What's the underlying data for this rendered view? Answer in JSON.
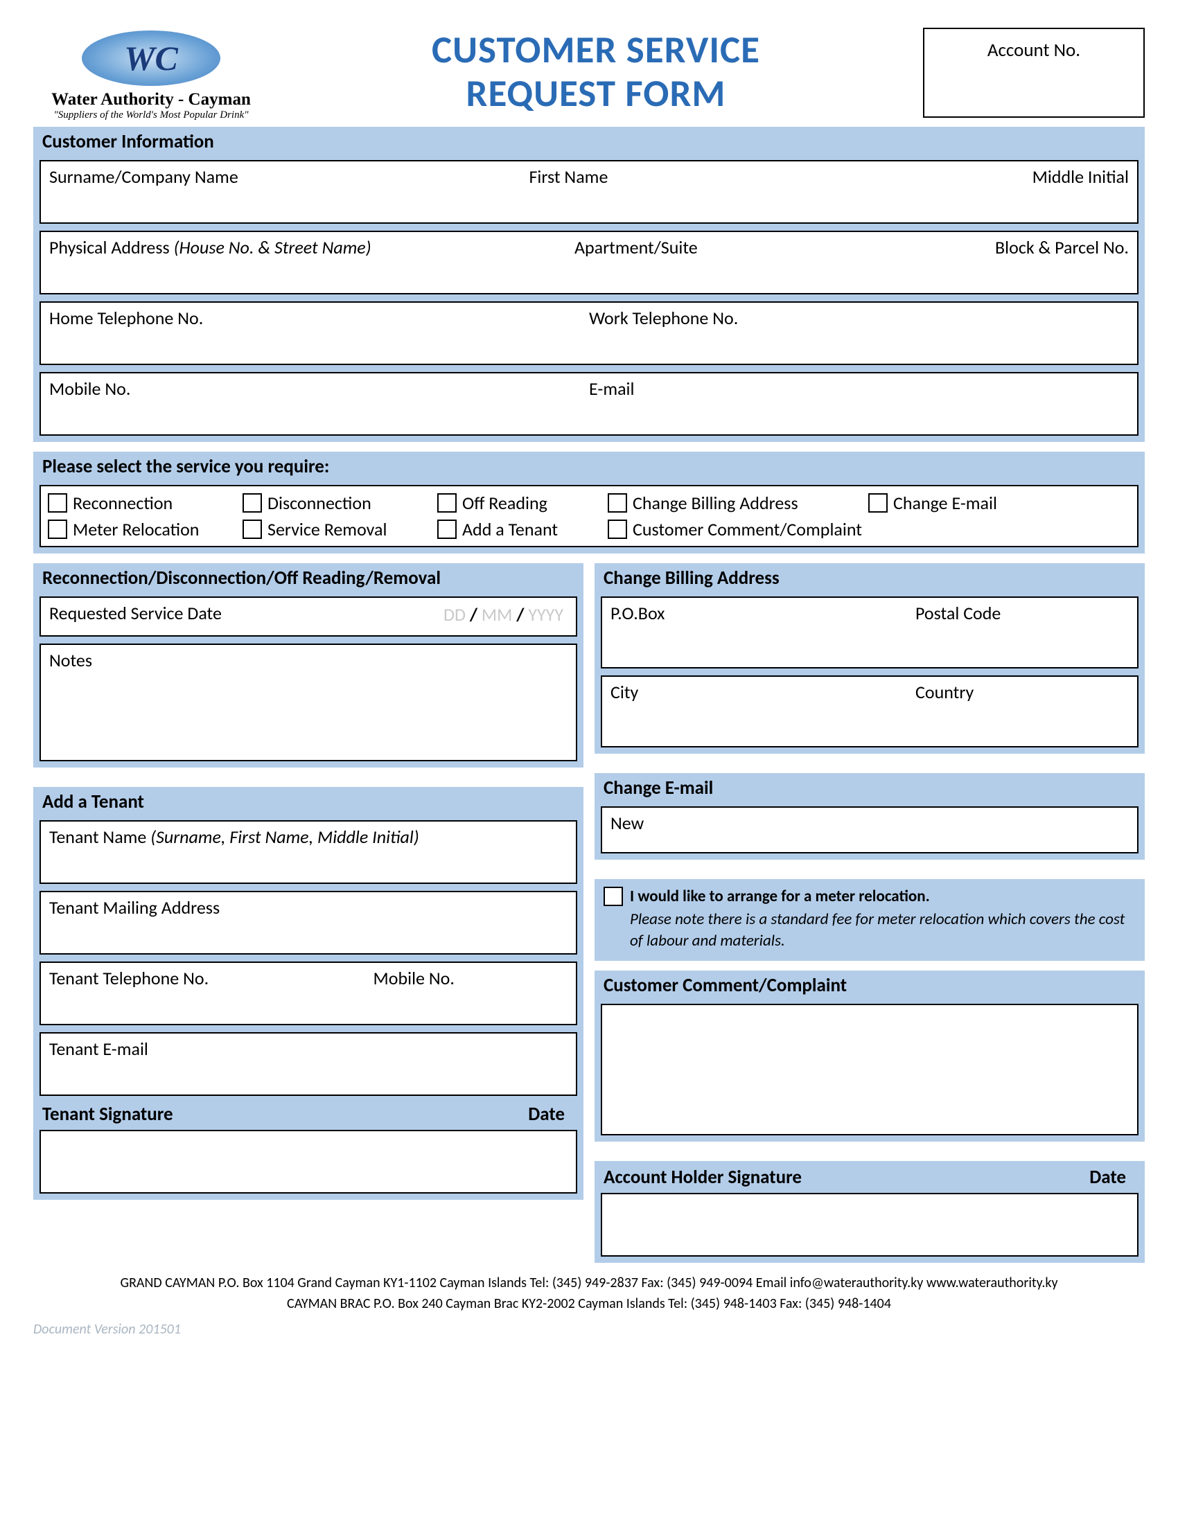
{
  "header": {
    "logo_initials": "WC",
    "org_name": "Water Authority - Cayman",
    "tagline": "\"Suppliers of the World's Most Popular Drink\"",
    "title_line1": "CUSTOMER SERVICE",
    "title_line2": "REQUEST FORM",
    "account_no_label": "Account No."
  },
  "customer": {
    "heading": "Customer Information",
    "surname": "Surname/Company Name",
    "first_name": "First Name",
    "middle_initial": "Middle Initial",
    "phys_addr": "Physical Address ",
    "phys_addr_hint": "(House No. & Street Name)",
    "apt": "Apartment/Suite",
    "block": "Block & Parcel No.",
    "home_tel": "Home Telephone No.",
    "work_tel": "Work Telephone No.",
    "mobile": "Mobile No.",
    "email": "E-mail"
  },
  "service_select": {
    "heading": "Please select the service you require:",
    "options_row1": [
      "Reconnection",
      "Disconnection",
      "Off Reading",
      "Change Billing Address",
      "Change E-mail"
    ],
    "options_row2": [
      "Meter Relocation",
      "Service Removal",
      "Add a Tenant",
      "Customer Comment/Complaint"
    ]
  },
  "left": {
    "rdo_heading": "Reconnection/Disconnection/Off Reading/Removal",
    "req_date_label": "Requested Service Date",
    "date_dd": "DD",
    "date_sep": " / ",
    "date_mm": "MM",
    "date_yyyy": "YYYY",
    "notes": "Notes",
    "tenant_heading": "Add a Tenant",
    "tenant_name": "Tenant Name ",
    "tenant_name_hint": "(Surname, First Name, Middle Initial)",
    "tenant_mail": "Tenant Mailing Address",
    "tenant_tel": "Tenant Telephone No.",
    "tenant_mobile": "Mobile No.",
    "tenant_email": "Tenant E-mail",
    "tenant_sig": "Tenant Signature",
    "date_label": "Date"
  },
  "right": {
    "billing_heading": "Change Billing Address",
    "pobox": "P.O.Box",
    "postal": "Postal Code",
    "city": "City",
    "country": "Country",
    "email_heading": "Change E-mail",
    "email_new": "New",
    "meter_line1": "I would like to arrange for a meter relocation.",
    "meter_line2": "Please note there is a standard fee for meter relocation which covers the cost of labour and materials.",
    "comment_heading": "Customer Comment/Complaint",
    "holder_sig": "Account Holder Signature",
    "date_label": "Date"
  },
  "footer": {
    "line1": "GRAND CAYMAN P.O. Box 1104 Grand Cayman KY1-1102 Cayman Islands Tel: (345) 949-2837 Fax: (345) 949-0094 Email info@waterauthority.ky www.waterauthority.ky",
    "line2": "CAYMAN BRAC P.O. Box 240 Cayman Brac KY2-2002 Cayman Islands Tel: (345) 948-1403 Fax: (345) 948-1404",
    "version": "Document Version 201501"
  }
}
